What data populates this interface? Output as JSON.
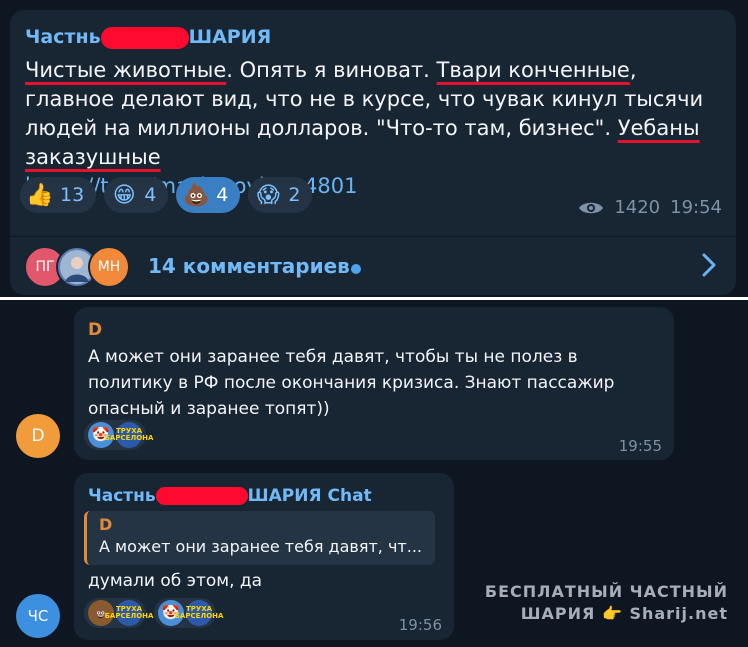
{
  "post": {
    "sender_prefix": "Частнь",
    "sender_suffix": "ШАРИЯ",
    "text_1": "Чистые животные",
    "text_2": ". Опять я виноват. ",
    "text_3": "Твари конченные",
    "text_4": ", главное делают вид, что не в курсе, что чувак кинул тысячи людей на миллионы долларов. \"Что-то там, бизнес\". ",
    "text_5": "Уебаны заказушные",
    "link": "https://t.me/mashmoyka/14801",
    "reactions": [
      {
        "emoji": "👍",
        "count": "13",
        "active": false
      },
      {
        "emoji": "😁",
        "count": "4",
        "active": false
      },
      {
        "emoji": "💩",
        "count": "4",
        "active": true
      },
      {
        "emoji": "😱",
        "count": "2",
        "active": false
      }
    ],
    "views": "1420",
    "time": "19:54",
    "comments_label": "14 комментариев",
    "avatars": [
      {
        "initials": "ПГ",
        "color": "#e2576b"
      },
      {
        "initials": "",
        "color": "#5a7fb0"
      },
      {
        "initials": "МН",
        "color": "#f08a3a"
      }
    ]
  },
  "comments": [
    {
      "avatar": "D",
      "avatar_color": "#f29b3a",
      "sender": "D",
      "sender_color": "#e38a3a",
      "text": "А может они заранее тебя давят, чтобы ты не полез в политику в РФ после окончания кризиса. Знают пассажир опасный и заранее топят))",
      "reactions": [
        "🤡",
        "ТРУХА БАРСЕЛОНА"
      ],
      "time": "19:55"
    },
    {
      "avatar": "ЧС",
      "avatar_color": "#3d8fe0",
      "sender_prefix": "Частнь",
      "sender_suffix": "ШАРИЯ Chat",
      "sender_color": "#71baf7",
      "reply_sender": "D",
      "reply_text": "А может они заранее тебя давят, чт...",
      "text": "думали об этом, да",
      "reactions": [
        "💩",
        "ТРУХА БАРСЕЛОНА",
        "🤡",
        "ТРУХА БАРСЕЛОНА"
      ],
      "time": "19:56"
    }
  ],
  "watermark": {
    "line1": "БЕСПЛАТНЫЙ ЧАСТНЫЙ",
    "line2_a": "ШАРИЯ",
    "line2_hand": "👉",
    "line2_b": "Sharij.net"
  },
  "colors": {
    "background": "#0e1621",
    "bubble": "#182533",
    "accent": "#71baf7",
    "redaction": "#ff0a2e"
  }
}
